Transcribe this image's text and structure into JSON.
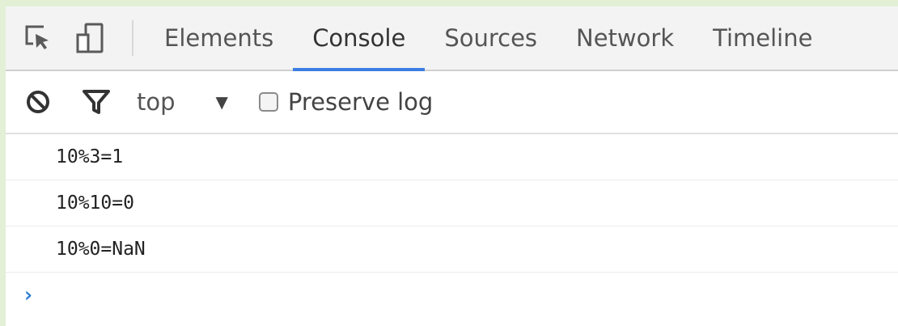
{
  "tabs": [
    {
      "label": "Elements"
    },
    {
      "label": "Console"
    },
    {
      "label": "Sources"
    },
    {
      "label": "Network"
    },
    {
      "label": "Timeline"
    }
  ],
  "active_tab": "Console",
  "toolbar": {
    "context": "top",
    "preserve_log_label": "Preserve log",
    "preserve_log_checked": false
  },
  "console": {
    "messages": [
      "10%3=1",
      "10%10=0",
      "10%0=NaN"
    ],
    "prompt_symbol": "›"
  },
  "colors": {
    "accent": "#3d7de3",
    "prompt": "#2b7cd3",
    "frame": "#e3f0d6"
  },
  "icons": {
    "inspect": "inspect-element-icon",
    "device": "device-mode-icon",
    "clear": "clear-console-icon",
    "filter": "filter-icon",
    "dropdown": "dropdown-arrow-icon"
  }
}
